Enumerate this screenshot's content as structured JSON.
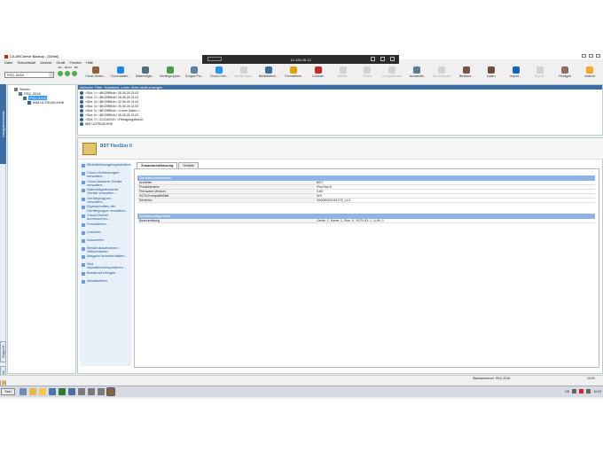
{
  "window": {
    "title": "CA ARCserve Backup - [Gerät]"
  },
  "rdp": {
    "address": "10.128.45.12"
  },
  "menu": [
    "Datei",
    "Schnellstart",
    "Ansicht",
    "Gerät",
    "Fenster",
    "Hilfe"
  ],
  "server_combo": {
    "value": "PDC-2016",
    "labels": [
      "Job",
      "Bereit",
      "Bis"
    ]
  },
  "toolbar": [
    {
      "label": "Cloud-Verbin...",
      "color": "#8c6239",
      "enabled": true
    },
    {
      "label": "Cloud-basier...",
      "color": "#1e88e5",
      "enabled": true
    },
    {
      "label": "Datenträger...",
      "color": "#546e7a",
      "enabled": true
    },
    {
      "label": "Gerätegruppen",
      "color": "#43a047",
      "enabled": true
    },
    {
      "label": "Gruppe Pro...",
      "color": "#5e7fa8",
      "enabled": true
    },
    {
      "label": "Cloud-Ordn...",
      "color": "#2196f3",
      "enabled": true
    },
    {
      "label": "Zeichen fest...",
      "color": "#9e9e9e",
      "enabled": false
    },
    {
      "label": "Bibliotheken...",
      "color": "#3a6ea5",
      "enabled": true
    },
    {
      "label": "Formatieren",
      "color": "#e0a100",
      "enabled": true
    },
    {
      "label": "Löschen",
      "color": "#c62828",
      "enabled": true
    },
    {
      "label": "Straffen",
      "color": "#9e9e9e",
      "enabled": false
    },
    {
      "label": "Prüfen",
      "color": "#9e9e9e",
      "enabled": false
    },
    {
      "label": "Komprimieren",
      "color": "#9e9e9e",
      "enabled": false
    },
    {
      "label": "Auswerfen",
      "color": "#607d8b",
      "enabled": true
    },
    {
      "label": "Neu erfassen",
      "color": "#9e9e9e",
      "enabled": false
    },
    {
      "label": "Bestand...",
      "color": "#795548",
      "enabled": true
    },
    {
      "label": "Laden",
      "color": "#6d4c41",
      "enabled": true
    },
    {
      "label": "Import...",
      "color": "#1565c0",
      "enabled": true
    },
    {
      "label": "Export...",
      "color": "#9e9e9e",
      "enabled": false
    },
    {
      "label": "Reinigen",
      "color": "#8d6e63",
      "enabled": true
    },
    {
      "label": "Ansicht",
      "color": "#f9a825",
      "enabled": true
    }
  ],
  "leftstrip": {
    "navigation": "Navigationsleiste",
    "support": "Support",
    "feedback": "Feedback"
  },
  "tree": [
    {
      "label": "Server",
      "indent": 1
    },
    {
      "label": "PDC-2016",
      "indent": 2
    },
    {
      "label": "PGC-2016",
      "indent": 3,
      "selected": true
    },
    {
      "label": "IBM ULTRIUM-HH6",
      "indent": 4
    }
  ],
  "slot_list": {
    "header": "Aktueller Filter: Standard, Leere Slots nicht anzeigen",
    "items": [
      "<Slot: 1> <BKZ5R6vb> 26.05.26 21:02",
      "<Slot: 2> <BKZ5R6vb> 26.05.26 21:02",
      "<Slot: 3> <BKZ5R6vb> 02.06.26 21:02",
      "<Slot: 4> <BKZ5R6vb> 26.05.26 21:02",
      "<Slot: 5> <BKZ5R6vb> <Leere Daten >",
      "<Slot: 6> <BKZ5R6vb> 26.05.26 21:02",
      "<Slot: 7> <CLEANXX> <Reinigungsband>",
      "IBM ULTRIUM-HH6"
    ]
  },
  "device": {
    "name": "BDT FlexStor II"
  },
  "tasks": [
    "Bibliotheksangelegenheiten...",
    "Cloud-Verbindungen verwalten...",
    "Cloud-basierte Geräte verwalten...",
    "Datenträgerbasierte Geräte verwalten...",
    "Gerätegruppen verwalten...",
    "Eigenschaften der Gerätegruppe verwalten...",
    "Cloud-Ordner durchsuchen...",
    "Formatieren...",
    "Löschen...",
    "Auswerfen",
    "Bestandsaufnahme / Offlinebänder",
    "Magazin laden/entladen...",
    "Slot importieren/exportieren...",
    "Bandkopf reinigen...",
    "Aktualisieren"
  ],
  "tabs": [
    "Zusammenfassung",
    "Details"
  ],
  "info_section": {
    "title": "Geräteinformationen",
    "rows": [
      {
        "k": "Anbieter",
        "v": "BDT"
      },
      {
        "k": "Produktname",
        "v": "FlexStor II"
      },
      {
        "k": "Firmware-Version",
        "v": "5.80"
      },
      {
        "k": "SCSI-Kompatibilität",
        "v": "N/V"
      },
      {
        "k": "Seriennr.",
        "v": "00000000102179_LL0"
      }
    ]
  },
  "config_section": {
    "title": "Gerätekonfiguration",
    "rows": [
      {
        "k": "Beschreibung",
        "v": "Gerät: 1, Karte: 2, Bus: 0, SCSI ID: 1, LUN: 1"
      }
    ]
  },
  "status": {
    "server": "Standardserver: PDC-2016",
    "time": "10:03"
  },
  "taskbar": {
    "start": "Start",
    "apps": [
      "#6b8eb5",
      "#e8b84a",
      "#f2c94c",
      "#4a78a8",
      "#2e7d32",
      "#4a6fa5",
      "#7a7a7a",
      "#7a7a7a",
      "#7a7a7a",
      "#8c6239"
    ],
    "lang": "DE",
    "time": "10:03"
  }
}
